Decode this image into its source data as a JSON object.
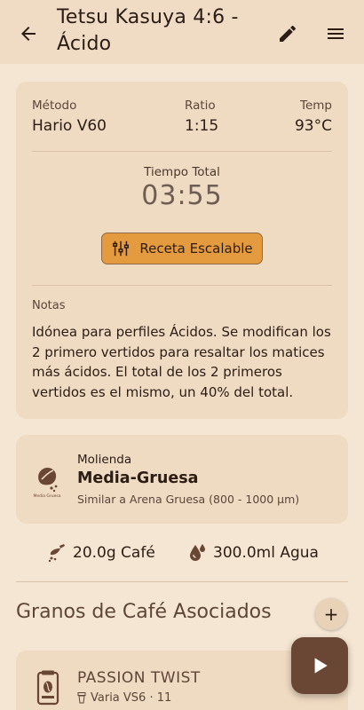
{
  "header": {
    "title": "Tetsu Kasuya 4:6 - Ácido",
    "back_icon": "arrow-left-icon",
    "edit_icon": "pencil-icon",
    "menu_icon": "hamburger-menu-icon"
  },
  "recipe": {
    "method_label": "Método",
    "method_value": "Hario V60",
    "ratio_label": "Ratio",
    "ratio_value": "1:15",
    "temp_label": "Temp",
    "temp_value": "93°C",
    "total_time_label": "Tiempo Total",
    "total_time_value": "03:55",
    "scale_button_label": "Receta Escalable",
    "notes_label": "Notas",
    "notes_text": "Idónea para perfiles Ácidos. Se modifican los 2 primero vertidos para resaltar los matices más ácidos. El total de los 2 primeros vertidos es el mismo, un 40% del total."
  },
  "grind": {
    "label": "Molienda",
    "value": "Media-Gruesa",
    "description": "Similar a Arena Gruesa (800 - 1000 µm)",
    "icon_caption": "Media Gruesa"
  },
  "quantities": {
    "coffee": "20.0g Café",
    "water": "300.0ml Agua"
  },
  "beans_section": {
    "title": "Granos de Café Asociados",
    "add_label": "+",
    "items": [
      {
        "name": "PASSION TWIST",
        "grinder": "Varia VS6 · 11"
      }
    ]
  },
  "colors": {
    "background": "#f5e6d3",
    "card": "#efdac2",
    "accent_button": "#e49b3f",
    "fab": "#6a4634"
  }
}
